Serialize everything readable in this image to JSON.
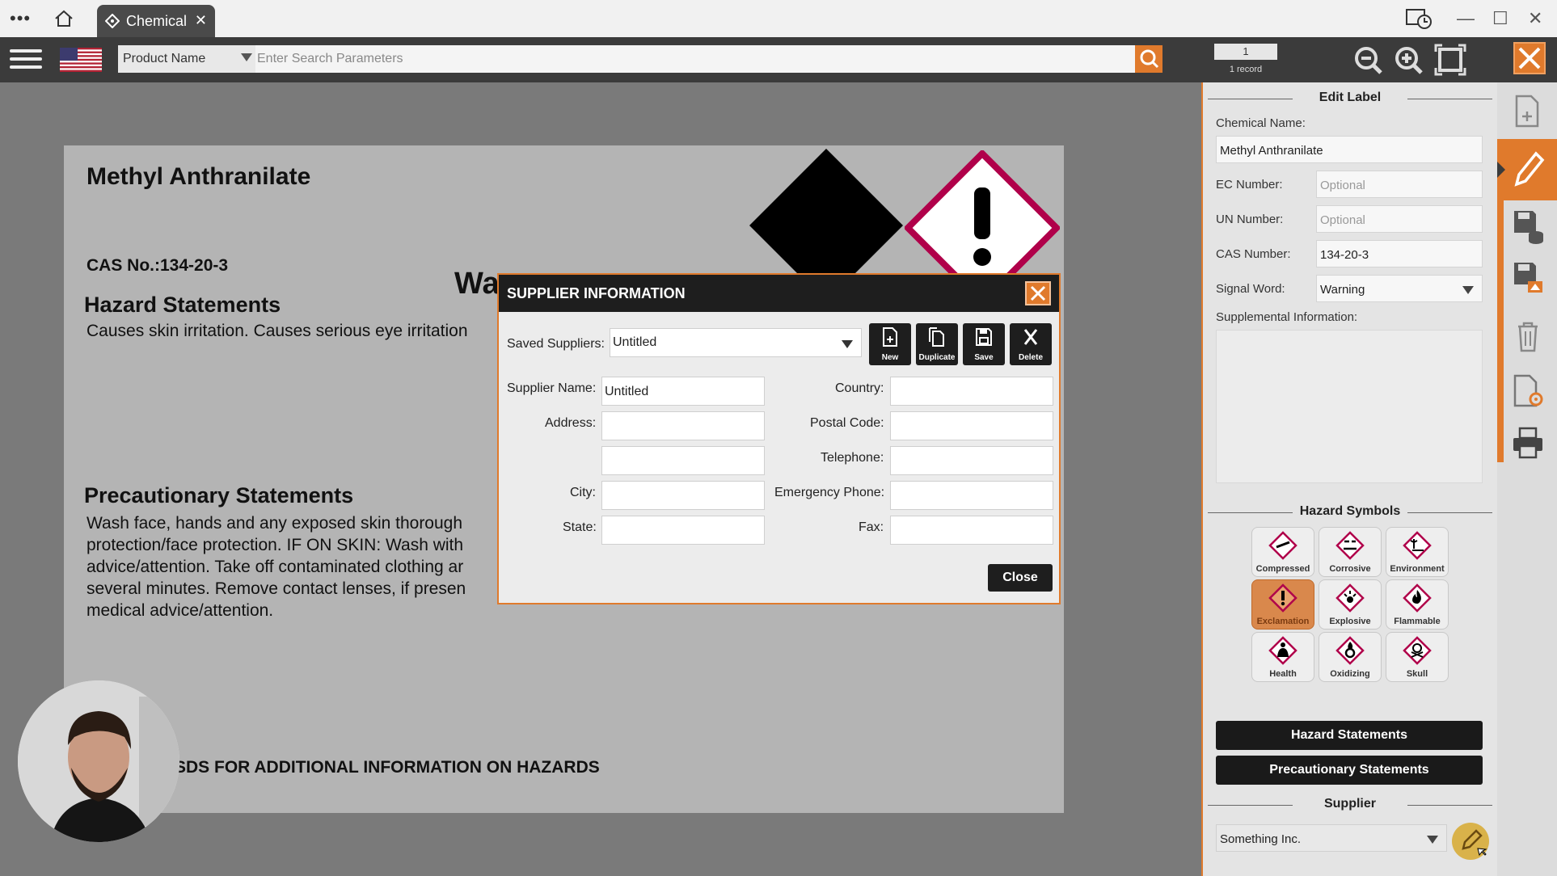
{
  "browser": {
    "tab_label": "Chemical"
  },
  "toolbar": {
    "search_field_select": "Product Name",
    "search_placeholder": "Enter Search Parameters",
    "record_number": "1",
    "record_count_label": "1 record"
  },
  "label": {
    "chemical_name": "Methyl Anthranilate",
    "cas_line": "CAS No.:134-20-3",
    "signal_word_partial": "Wa",
    "hazard_heading": "Hazard Statements",
    "hazard_text": "Causes skin irritation. Causes serious eye irritation",
    "precaution_heading": "Precautionary Statements",
    "precaution_text": "Wash face, hands and any exposed skin thorough\nprotection/face protection. IF ON SKIN: Wash with\nadvice/attention. Take off contaminated clothing ar\nseveral minutes. Remove contact lenses, if presen\nmedical advice/attention.",
    "sds_note": "SDS FOR ADDITIONAL INFORMATION ON HAZARDS"
  },
  "modal": {
    "title": "SUPPLIER INFORMATION",
    "saved_suppliers_label": "Saved Suppliers:",
    "saved_suppliers_value": "Untitled",
    "tools": [
      {
        "label": "New",
        "icon": "new-doc-icon"
      },
      {
        "label": "Duplicate",
        "icon": "duplicate-icon"
      },
      {
        "label": "Save",
        "icon": "save-icon"
      },
      {
        "label": "Delete",
        "icon": "delete-x-icon"
      }
    ],
    "fields": {
      "supplier_name_label": "Supplier Name:",
      "supplier_name_value": "Untitled",
      "address_label": "Address:",
      "city_label": "City:",
      "state_label": "State:",
      "country_label": "Country:",
      "postal_label": "Postal Code:",
      "telephone_label": "Telephone:",
      "emergency_label": "Emergency Phone:",
      "fax_label": "Fax:"
    },
    "close_label": "Close"
  },
  "edit_panel": {
    "heading": "Edit Label",
    "chemical_name_label": "Chemical Name:",
    "chemical_name_value": "Methyl Anthranilate",
    "ec_label": "EC Number:",
    "ec_placeholder": "Optional",
    "un_label": "UN Number:",
    "un_placeholder": "Optional",
    "cas_label": "CAS Number:",
    "cas_value": "134-20-3",
    "signal_label": "Signal Word:",
    "signal_value": "Warning",
    "supplemental_label": "Supplemental Information:",
    "hazard_symbols_heading": "Hazard Symbols",
    "hazard_symbols": [
      {
        "label": "Compressed",
        "active": false
      },
      {
        "label": "Corrosive",
        "active": false
      },
      {
        "label": "Environment",
        "active": false
      },
      {
        "label": "Exclamation",
        "active": true
      },
      {
        "label": "Explosive",
        "active": false
      },
      {
        "label": "Flammable",
        "active": false
      },
      {
        "label": "Health",
        "active": false
      },
      {
        "label": "Oxidizing",
        "active": false
      },
      {
        "label": "Skull",
        "active": false
      }
    ],
    "hazard_statements_btn": "Hazard Statements",
    "precautionary_statements_btn": "Precautionary Statements",
    "supplier_heading": "Supplier",
    "supplier_value": "Something Inc."
  },
  "colors": {
    "accent": "#e07a2c",
    "dark": "#1e1e1e"
  }
}
